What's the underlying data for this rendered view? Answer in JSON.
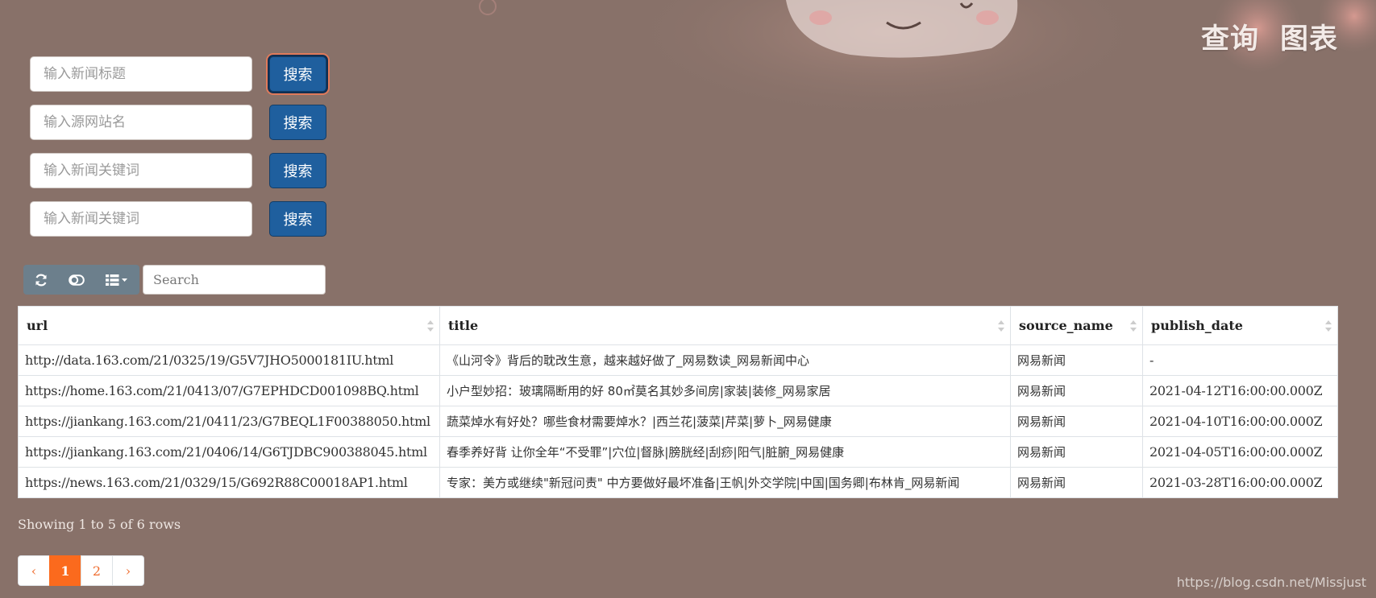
{
  "nav": {
    "query": "查询",
    "chart": "图表"
  },
  "search_forms": [
    {
      "placeholder": "输入新闻标题",
      "button": "搜索"
    },
    {
      "placeholder": "输入源网站名",
      "button": "搜索"
    },
    {
      "placeholder": "输入新闻关键词",
      "button": "搜索"
    },
    {
      "placeholder": "输入新闻关键词",
      "button": "搜索"
    }
  ],
  "toolbar": {
    "icons": [
      "refresh-icon",
      "toggle-icon",
      "columns-icon"
    ],
    "search_placeholder": "Search"
  },
  "table": {
    "columns": [
      "url",
      "title",
      "source_name",
      "publish_date"
    ],
    "rows": [
      {
        "url": "http://data.163.com/21/0325/19/G5V7JHO5000181IU.html",
        "title": "《山河令》背后的耽改生意，越来越好做了_网易数读_网易新闻中心",
        "source_name": "网易新闻",
        "publish_date": "-"
      },
      {
        "url": "https://home.163.com/21/0413/07/G7EPHDCD001098BQ.html",
        "title": "小户型妙招：玻璃隔断用的好 80㎡莫名其妙多间房|家装|装修_网易家居",
        "source_name": "网易新闻",
        "publish_date": "2021-04-12T16:00:00.000Z"
      },
      {
        "url": "https://jiankang.163.com/21/0411/23/G7BEQL1F00388050.html",
        "title": "蔬菜焯水有好处？哪些食材需要焯水？|西兰花|菠菜|芹菜|萝卜_网易健康",
        "source_name": "网易新闻",
        "publish_date": "2021-04-10T16:00:00.000Z"
      },
      {
        "url": "https://jiankang.163.com/21/0406/14/G6TJDBC900388045.html",
        "title": "春季养好背 让你全年“不受罪”|穴位|督脉|膀胱经|刮痧|阳气|脏腑_网易健康",
        "source_name": "网易新闻",
        "publish_date": "2021-04-05T16:00:00.000Z"
      },
      {
        "url": "https://news.163.com/21/0329/15/G692R88C00018AP1.html",
        "title": "专家：美方或继续\"新冠问责\" 中方要做好最坏准备|王帆|外交学院|中国|国务卿|布林肯_网易新闻",
        "source_name": "网易新闻",
        "publish_date": "2021-03-28T16:00:00.000Z"
      }
    ]
  },
  "summary": "Showing 1 to 5 of 6 rows",
  "pagination": {
    "prev": "‹",
    "pages": [
      "1",
      "2"
    ],
    "next": "›",
    "current": "1"
  },
  "watermark": "https://blog.csdn.net/Missjust",
  "colors": {
    "background": "#887169",
    "button": "#1f5f9e",
    "accent": "#fb6a1d",
    "toolbar": "#6c7f8c"
  }
}
